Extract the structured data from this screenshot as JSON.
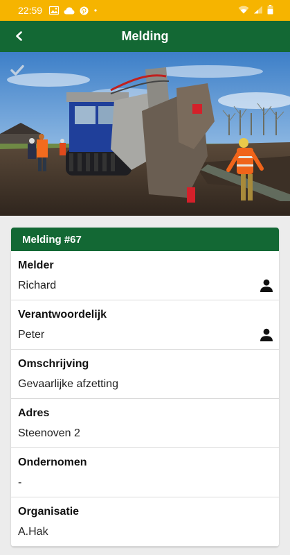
{
  "status_bar": {
    "time": "22:59",
    "icons": [
      "image-icon",
      "cloud-icon",
      "pinterest-icon",
      "dot-icon",
      "wifi-icon",
      "signal-icon",
      "battery-icon"
    ]
  },
  "app_bar": {
    "title": "Melding",
    "back_icon": "back-arrow-icon"
  },
  "hero": {
    "overlay_icon": "checkmark-icon"
  },
  "card": {
    "header": "Melding #67",
    "rows": [
      {
        "label": "Melder",
        "value": "Richard",
        "icon": "person-icon"
      },
      {
        "label": "Verantwoordelijk",
        "value": "Peter",
        "icon": "person-icon"
      },
      {
        "label": "Omschrijving",
        "value": "Gevaarlijke afzetting"
      },
      {
        "label": "Adres",
        "value": "Steenoven 2"
      },
      {
        "label": "Ondernomen",
        "value": "-"
      },
      {
        "label": "Organisatie",
        "value": "A.Hak"
      }
    ]
  },
  "colors": {
    "status_bar": "#f6b400",
    "primary_green": "#136834",
    "background": "#ececec"
  }
}
